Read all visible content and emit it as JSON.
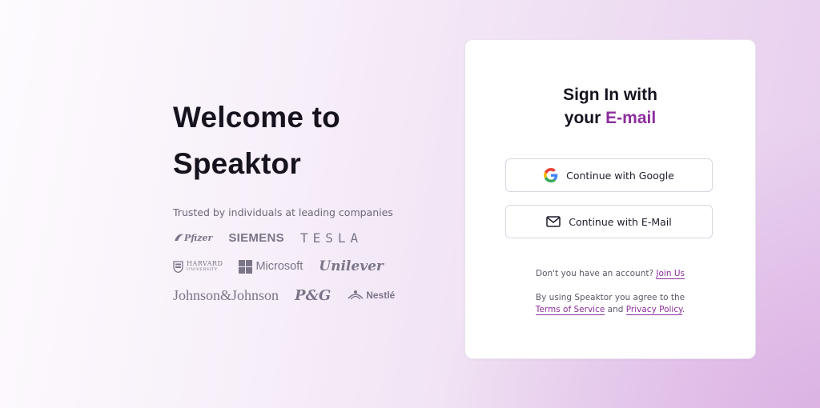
{
  "left": {
    "headline_line1": "Welcome to",
    "headline_line2": "Speaktor",
    "trusted_text": "Trusted by individuals at leading companies",
    "logos": {
      "pfizer": "Pfizer",
      "siemens": "SIEMENS",
      "tesla": "TESLA",
      "harvard_line1": "HARVARD",
      "harvard_line2": "UNIVERSITY",
      "microsoft": "Microsoft",
      "unilever": "Unilever",
      "jnj": "Johnson&Johnson",
      "pg": "P&G",
      "nestle": "Nestlé"
    }
  },
  "card": {
    "title_line1": "Sign In with",
    "title_line2_prefix": "your",
    "title_line2_accent": "E-mail",
    "google_button": "Continue with Google",
    "email_button": "Continue with E-Mail",
    "signup_prompt": "Don't you have an account?",
    "signup_link": "Join Us",
    "terms_prefix": "By using Speaktor you agree to the",
    "terms_link": "Terms of Service",
    "terms_and": "and",
    "privacy_link": "Privacy Policy",
    "terms_suffix": "."
  },
  "colors": {
    "accent": "#8c2e9d",
    "heading": "#16131f",
    "logo_gray": "#7a7589",
    "bg_gradient_end": "#e7cdee"
  },
  "icons": {
    "google_button_icon": "google-g-icon",
    "email_button_icon": "envelope-icon"
  }
}
